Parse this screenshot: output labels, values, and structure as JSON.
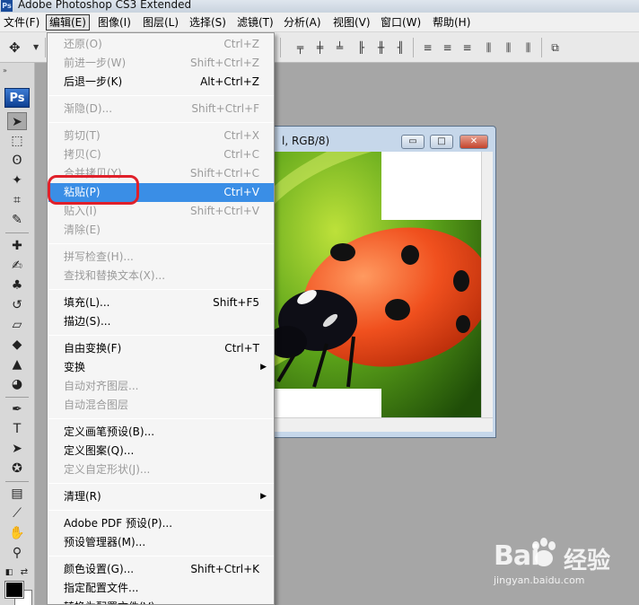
{
  "titlebar": {
    "logo": "Ps",
    "title": "Adobe Photoshop CS3 Extended"
  },
  "menubar": {
    "items": [
      "文件(F)",
      "编辑(E)",
      "图像(I)",
      "图层(L)",
      "选择(S)",
      "滤镜(T)",
      "分析(A)",
      "视图(V)",
      "窗口(W)",
      "帮助(H)"
    ],
    "active_index": 1
  },
  "options_bar": {
    "tool_icon": "move-tool-icon"
  },
  "panel": {
    "collapse_glyph": "»",
    "ps_badge": "Ps"
  },
  "document": {
    "title": "l, RGB/8)",
    "controls": {
      "minimize": "▭",
      "maximize": "□",
      "close": "✕"
    }
  },
  "edit_menu": {
    "items": [
      {
        "label": "还原(O)",
        "shortcut": "Ctrl+Z",
        "disabled": true
      },
      {
        "label": "前进一步(W)",
        "shortcut": "Shift+Ctrl+Z",
        "disabled": true
      },
      {
        "label": "后退一步(K)",
        "shortcut": "Alt+Ctrl+Z",
        "disabled": false
      },
      {
        "sep": true
      },
      {
        "label": "渐隐(D)...",
        "shortcut": "Shift+Ctrl+F",
        "disabled": true
      },
      {
        "sep": true
      },
      {
        "label": "剪切(T)",
        "shortcut": "Ctrl+X",
        "disabled": true
      },
      {
        "label": "拷贝(C)",
        "shortcut": "Ctrl+C",
        "disabled": true
      },
      {
        "label": "合并拷贝(Y)",
        "shortcut": "Shift+Ctrl+C",
        "disabled": true
      },
      {
        "label": "粘贴(P)",
        "shortcut": "Ctrl+V",
        "disabled": false,
        "highlight": true
      },
      {
        "label": "贴入(I)",
        "shortcut": "Shift+Ctrl+V",
        "disabled": true
      },
      {
        "label": "清除(E)",
        "shortcut": "",
        "disabled": true
      },
      {
        "sep": true
      },
      {
        "label": "拼写检查(H)...",
        "shortcut": "",
        "disabled": true
      },
      {
        "label": "查找和替换文本(X)...",
        "shortcut": "",
        "disabled": true
      },
      {
        "sep": true
      },
      {
        "label": "填充(L)...",
        "shortcut": "Shift+F5",
        "disabled": false
      },
      {
        "label": "描边(S)...",
        "shortcut": "",
        "disabled": false
      },
      {
        "sep": true
      },
      {
        "label": "自由变换(F)",
        "shortcut": "Ctrl+T",
        "disabled": false
      },
      {
        "label": "变换",
        "shortcut": "",
        "disabled": false,
        "submenu": true
      },
      {
        "label": "自动对齐图层...",
        "shortcut": "",
        "disabled": true
      },
      {
        "label": "自动混合图层",
        "shortcut": "",
        "disabled": true
      },
      {
        "sep": true
      },
      {
        "label": "定义画笔预设(B)...",
        "shortcut": "",
        "disabled": false
      },
      {
        "label": "定义图案(Q)...",
        "shortcut": "",
        "disabled": false
      },
      {
        "label": "定义自定形状(J)...",
        "shortcut": "",
        "disabled": true
      },
      {
        "sep": true
      },
      {
        "label": "清理(R)",
        "shortcut": "",
        "disabled": false,
        "submenu": true
      },
      {
        "sep": true
      },
      {
        "label": "Adobe PDF 预设(P)...",
        "shortcut": "",
        "disabled": false
      },
      {
        "label": "预设管理器(M)...",
        "shortcut": "",
        "disabled": false
      },
      {
        "sep": true
      },
      {
        "label": "颜色设置(G)...",
        "shortcut": "Shift+Ctrl+K",
        "disabled": false
      },
      {
        "label": "指定配置文件...",
        "shortcut": "",
        "disabled": false
      },
      {
        "label": "转换为配置文件(V)...",
        "shortcut": "",
        "disabled": false
      }
    ]
  },
  "watermark": {
    "brand": "Bai",
    "brand_suffix": "经验",
    "url": "jingyan.baidu.com"
  },
  "colors": {
    "highlight": "#3a8ee6",
    "annotation": "#e0202a",
    "workspace": "#a6a6a6"
  }
}
